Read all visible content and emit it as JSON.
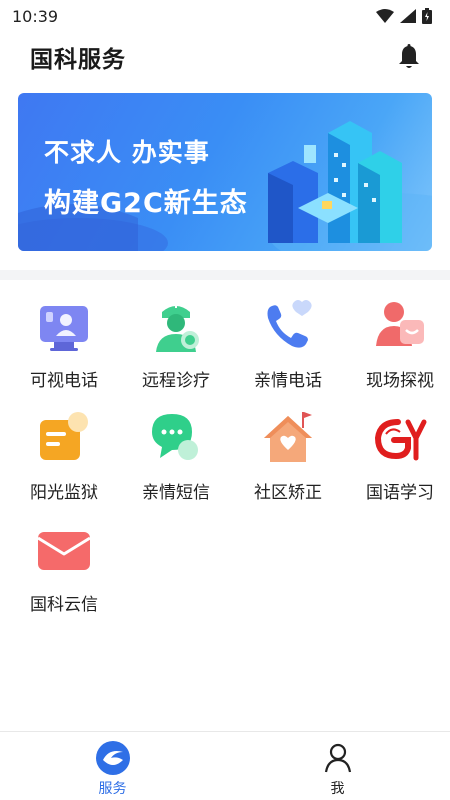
{
  "status_bar": {
    "time": "10:39"
  },
  "header": {
    "title": "国科服务"
  },
  "banner": {
    "line1": "不求人 办实事",
    "line2": "构建G2C新生态"
  },
  "services": [
    {
      "label": "可视电话",
      "icon": "video-phone-icon"
    },
    {
      "label": "远程诊疗",
      "icon": "doctor-icon"
    },
    {
      "label": "亲情电话",
      "icon": "heart-phone-icon"
    },
    {
      "label": "现场探视",
      "icon": "visit-icon"
    },
    {
      "label": "阳光监狱",
      "icon": "sunshine-prison-icon"
    },
    {
      "label": "亲情短信",
      "icon": "chat-icon"
    },
    {
      "label": "社区矫正",
      "icon": "community-icon"
    },
    {
      "label": "国语学习",
      "icon": "language-learning-icon"
    },
    {
      "label": "国科云信",
      "icon": "mail-icon"
    }
  ],
  "tabbar": {
    "tabs": [
      {
        "label": "服务",
        "active": true,
        "icon": "service-icon"
      },
      {
        "label": "我",
        "active": false,
        "icon": "user-icon"
      }
    ]
  },
  "colors": {
    "active_tab": "#2f6fe6",
    "banner_blue": "#3f78f2"
  }
}
